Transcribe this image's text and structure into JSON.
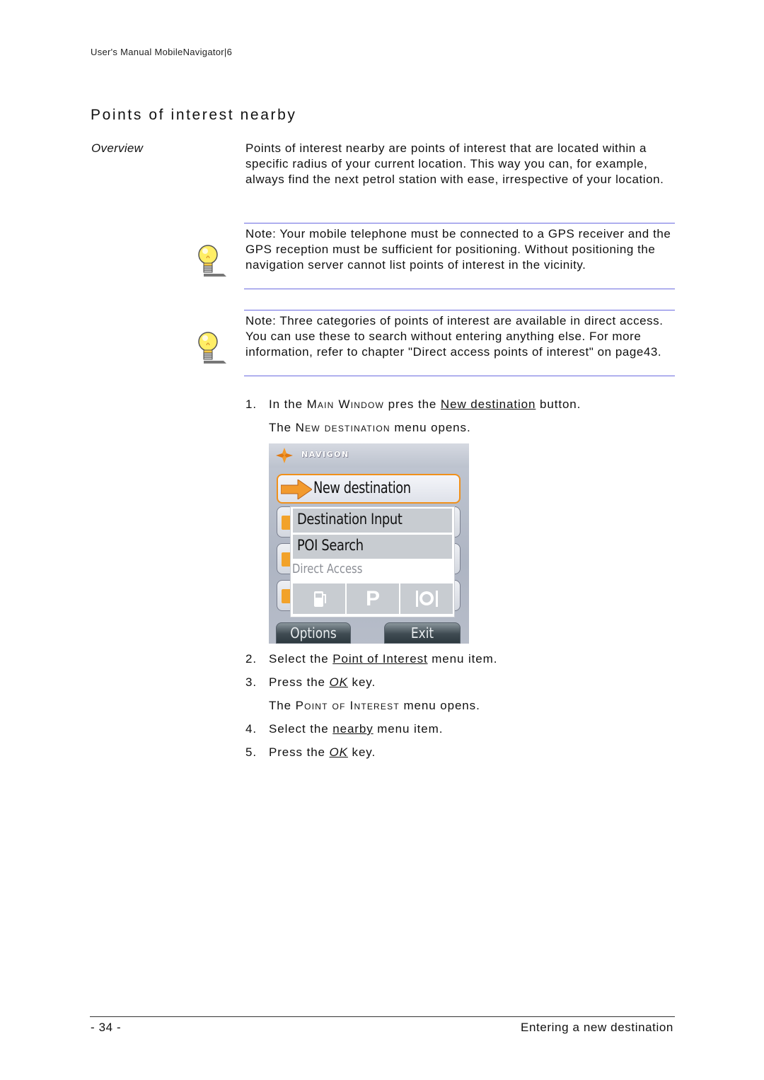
{
  "header": {
    "running_title": "User's Manual MobileNavigator|6"
  },
  "section": {
    "title": "Points of interest nearby",
    "side_label": "Overview",
    "overview": "Points of interest nearby are points of interest that are located within a specific radius of your current location. This way you can, for example, always find the next petrol station with ease, irrespective of your location."
  },
  "notes": [
    {
      "icon": "lightbulb-icon",
      "text": "Note: Your mobile telephone must be connected to a GPS receiver and the GPS reception must be sufficient for positioning. Without positioning the navigation server cannot list points of interest in the vicinity."
    },
    {
      "icon": "lightbulb-icon",
      "text": "Note: Three categories of points of interest are available in direct access. You can use these to search without entering anything else. For more information, refer to chapter \"Direct access points of interest\" on page43."
    }
  ],
  "steps": {
    "s1": {
      "num": "1.",
      "pre": "In the ",
      "sc": "Main Window",
      "mid": " pres the ",
      "link": "New destination",
      "post": " button."
    },
    "s1_result": {
      "pre": "The ",
      "sc": "New destination",
      "post": " menu opens."
    },
    "s2": {
      "num": "2.",
      "pre": "Select the ",
      "link": "Point of Interest",
      "post": " menu item."
    },
    "s3": {
      "num": "3.",
      "pre": "Press the ",
      "link": "OK",
      "post": " key."
    },
    "s3_result": {
      "pre": "The ",
      "sc": "Point of Interest",
      "post": " menu opens."
    },
    "s4": {
      "num": "4.",
      "pre": "Select the ",
      "link": "nearby",
      "post": " menu item."
    },
    "s5": {
      "num": "5.",
      "pre": "Press the ",
      "link": "OK",
      "post": " key."
    }
  },
  "phone": {
    "brand": "NAVIGON",
    "selected_button": "New destination",
    "popup_items": [
      "Destination Input",
      "POI Search"
    ],
    "direct_access_label": "Direct Access",
    "direct_access_tiles": [
      "petrol-station",
      "parking",
      "restaurant"
    ],
    "parking_glyph": "P",
    "softkeys": {
      "left": "Options",
      "right": "Exit"
    },
    "accent_color": "#f0901a"
  },
  "footer": {
    "page_number": "- 34 -",
    "chapter": "Entering a new destination"
  }
}
